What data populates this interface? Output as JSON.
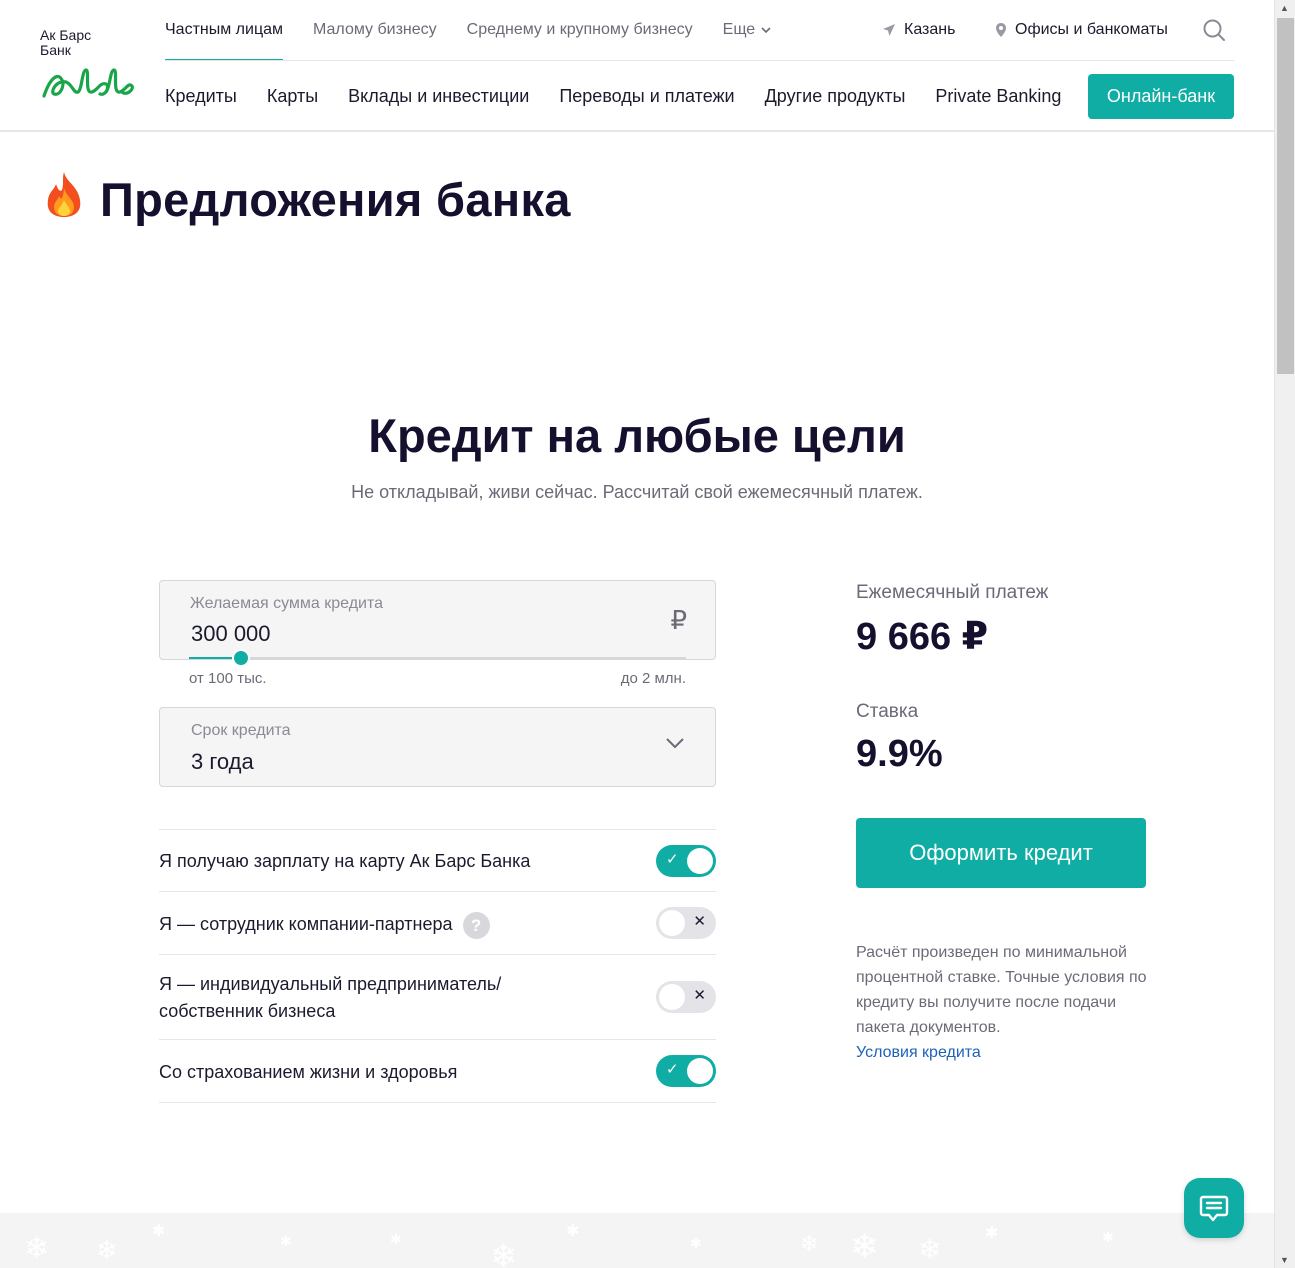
{
  "logo": {
    "line1": "Ак Барс",
    "line2": "Банк"
  },
  "topnav": {
    "items": [
      "Частным лицам",
      "Малому бизнесу",
      "Среднему и крупному бизнесу",
      "Еще"
    ],
    "city": "Казань",
    "offices": "Офисы и банкоматы"
  },
  "mainnav": {
    "items": [
      "Кредиты",
      "Карты",
      "Вклады и инвестиции",
      "Переводы и платежи",
      "Другие продукты",
      "Private Banking"
    ],
    "online_button": "Онлайн-банк"
  },
  "offers": {
    "title": "Предложения банка",
    "emoji": "🔥"
  },
  "credit": {
    "title": "Кредит на любые цели",
    "subtitle": "Не откладывай, живи сейчас. Рассчитай свой ежемесячный платеж.",
    "amount": {
      "label": "Желаемая сумма кредита",
      "value": "300 000",
      "currency": "₽",
      "min_label": "от 100 тыс.",
      "max_label": "до 2 млн.",
      "slider_fraction": 0.105
    },
    "term": {
      "label": "Срок кредита",
      "value": "3 года"
    },
    "options": [
      {
        "text": "Я получаю зарплату на карту Ак Барс Банка",
        "on": true
      },
      {
        "text": "Я — сотрудник компании-партнера",
        "on": false,
        "help": "?"
      },
      {
        "text": "Я — индивидуальный предприниматель/ собственник бизнеса",
        "line1": "Я — индивидуальный предприниматель/",
        "line2": "собственник бизнеса",
        "on": false
      },
      {
        "text": "Со страхованием жизни и здоровья",
        "on": true
      }
    ],
    "result": {
      "payment_label": "Ежемесячный платеж",
      "payment_value": "9 666 ₽",
      "rate_label": "Ставка",
      "rate_value": "9.9%",
      "apply_button": "Оформить кредит",
      "note": "Расчёт произведен по минимальной процентной ставке. Точные условия по кредиту вы получите после подачи пакета документов.",
      "terms_link": "Условия кредита"
    }
  },
  "colors": {
    "accent": "#0fada3",
    "text": "#16102e",
    "muted": "#6b6b78",
    "link": "#1d63b8"
  }
}
